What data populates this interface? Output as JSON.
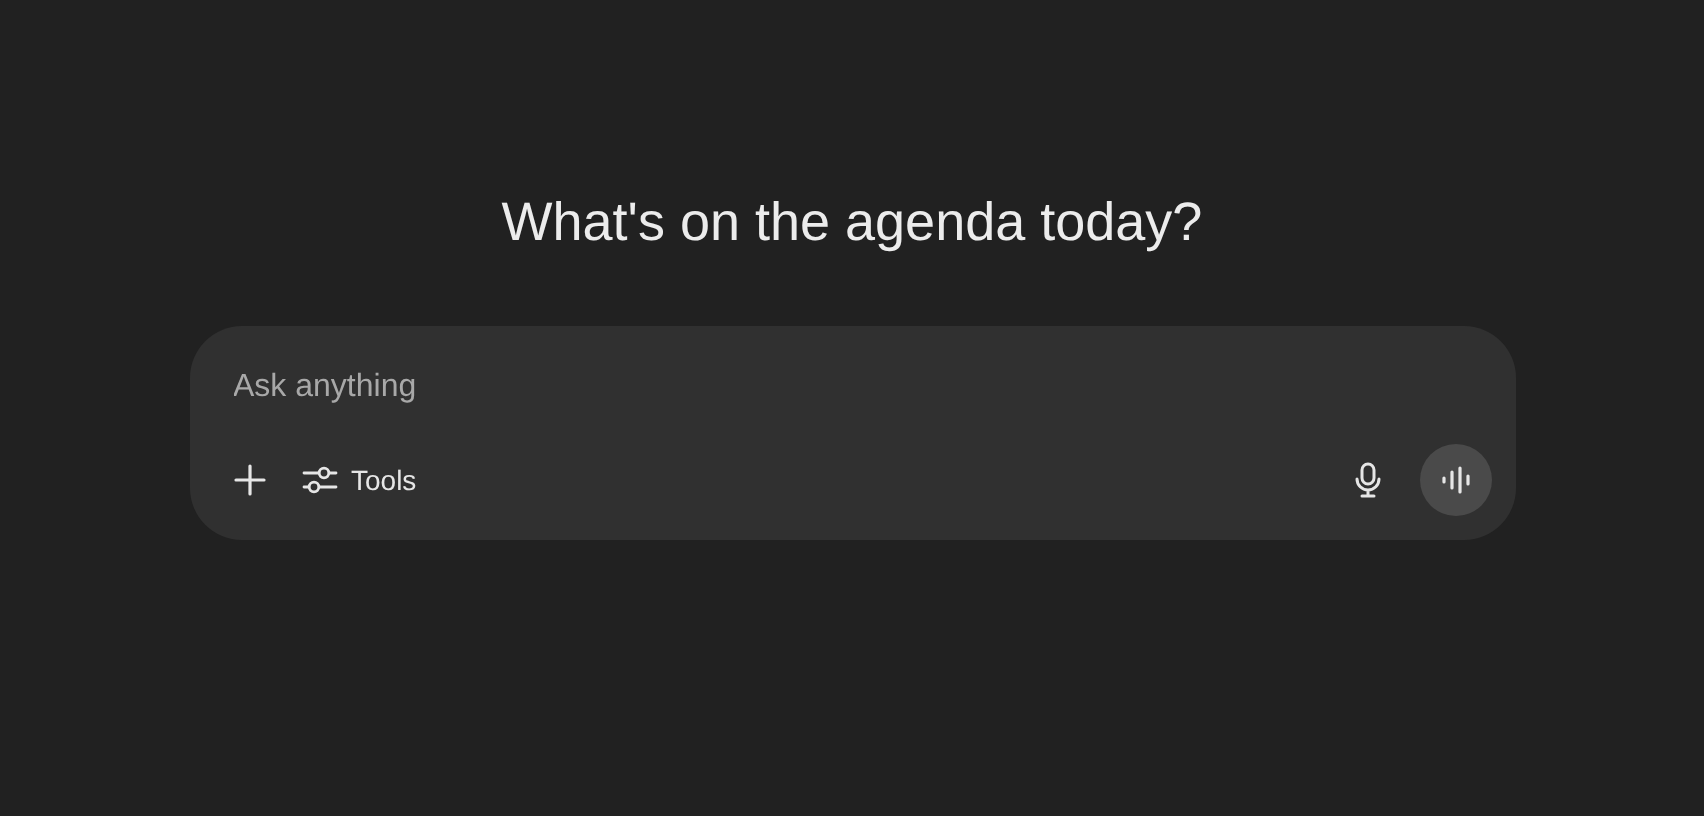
{
  "heading": "What's on the agenda today?",
  "composer": {
    "placeholder": "Ask anything",
    "tools_label": "Tools"
  }
}
